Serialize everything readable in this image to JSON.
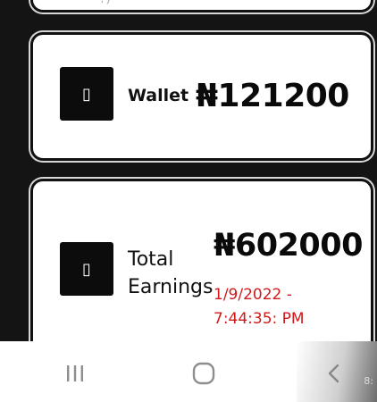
{
  "wallet_card": {
    "label": "Wallet",
    "amount": "₦121200",
    "icon_name": "image-placeholder-icon",
    "icon_glyph": "▯"
  },
  "earnings_card": {
    "label": "Total Earnings",
    "amount": "₦602000",
    "date": "1/9/2022 - 7:44:35: PM",
    "icon_name": "image-placeholder-icon",
    "icon_glyph": "▯"
  },
  "top_card": {
    "faded_text": "^, )"
  },
  "nav_bar": {
    "recents_icon": "recents-icon",
    "home_icon": "home-icon",
    "back_icon": "back-icon"
  },
  "corner_text": "8:",
  "colors": {
    "card_border": "#111111",
    "date_red": "#d01a1a",
    "background": "#141414"
  }
}
